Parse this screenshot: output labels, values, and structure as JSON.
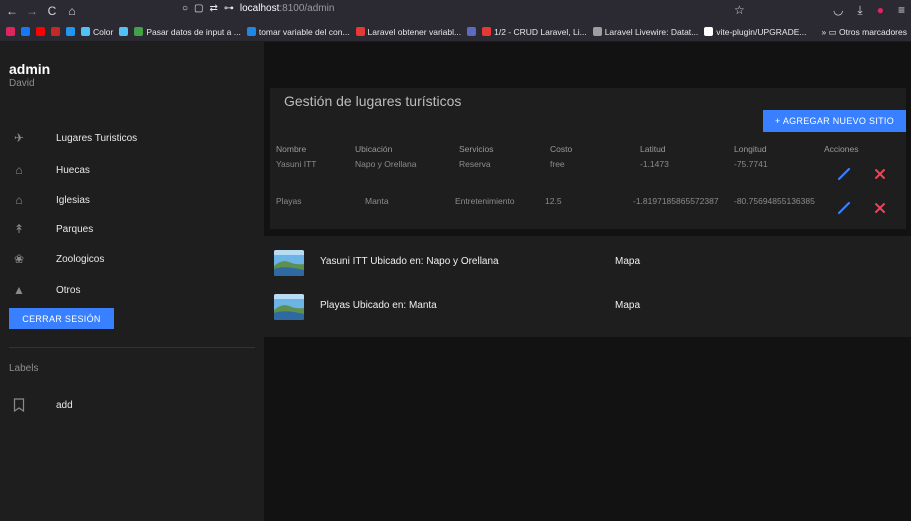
{
  "browser": {
    "url_host": "localhost",
    "url_path": ":8100/admin",
    "bookmarks": [
      {
        "label": "",
        "color": "#e0245e"
      },
      {
        "label": "",
        "color": "#1877f2"
      },
      {
        "label": "",
        "color": "#ff0000"
      },
      {
        "label": "",
        "color": "#c62828"
      },
      {
        "label": "",
        "color": "#2196f3"
      },
      {
        "label": "Color",
        "color": "#4fc3f7"
      },
      {
        "label": "",
        "color": "#4fc3f7"
      },
      {
        "label": "Pasar datos de input a ...",
        "color": "#43a047"
      },
      {
        "label": "tomar variable del con...",
        "color": "#1e88e5"
      },
      {
        "label": "Laravel obtener variabl...",
        "color": "#e53935"
      },
      {
        "label": "",
        "color": "#5c6bc0"
      },
      {
        "label": "1/2 - CRUD Laravel, Li...",
        "color": "#e53935"
      },
      {
        "label": "Laravel Livewire: Datat...",
        "color": "#9e9e9e"
      },
      {
        "label": "vite-plugin/UPGRADE...",
        "color": "#ffffff"
      }
    ],
    "other_bookmarks": "Otros marcadores"
  },
  "user": {
    "name": "admin",
    "subtitle": "David"
  },
  "menu": [
    {
      "label": "Lugares Turisticos",
      "icon": "airplane-icon"
    },
    {
      "label": "Huecas",
      "icon": "home-icon"
    },
    {
      "label": "Iglesias",
      "icon": "church-icon"
    },
    {
      "label": "Parques",
      "icon": "tree-icon"
    },
    {
      "label": "Zoologicos",
      "icon": "paw-icon"
    },
    {
      "label": "Otros",
      "icon": "warning-icon"
    }
  ],
  "logout_label": "CERRAR SESIÓN",
  "labels": {
    "heading": "Labels",
    "items": [
      {
        "label": "add",
        "icon": "bookmark-icon"
      }
    ]
  },
  "main": {
    "title": "Gestión de lugares turísticos",
    "add_button": "+ AGREGAR NUEVO SITIO",
    "columns": [
      "Nombre",
      "Ubicación",
      "Servicios",
      "Costo",
      "Latitud",
      "Longitud",
      "Acciones"
    ],
    "rows": [
      [
        "Yasuni ITT",
        "Napo y Orellana",
        "Reserva",
        "free",
        "-1.1473",
        "-75.7741"
      ],
      [
        "Playas",
        "Manta",
        "Entretenimiento",
        "12.5",
        "-1.8197185865572387",
        "-80.75694855136385"
      ]
    ],
    "list": [
      {
        "label": "Yasuni ITT Ubicado en: Napo y Orellana",
        "map": "Mapa"
      },
      {
        "label": "Playas Ubicado en: Manta",
        "map": "Mapa"
      }
    ]
  },
  "colors": {
    "accent": "#3880ff",
    "delete": "#eb445a"
  }
}
